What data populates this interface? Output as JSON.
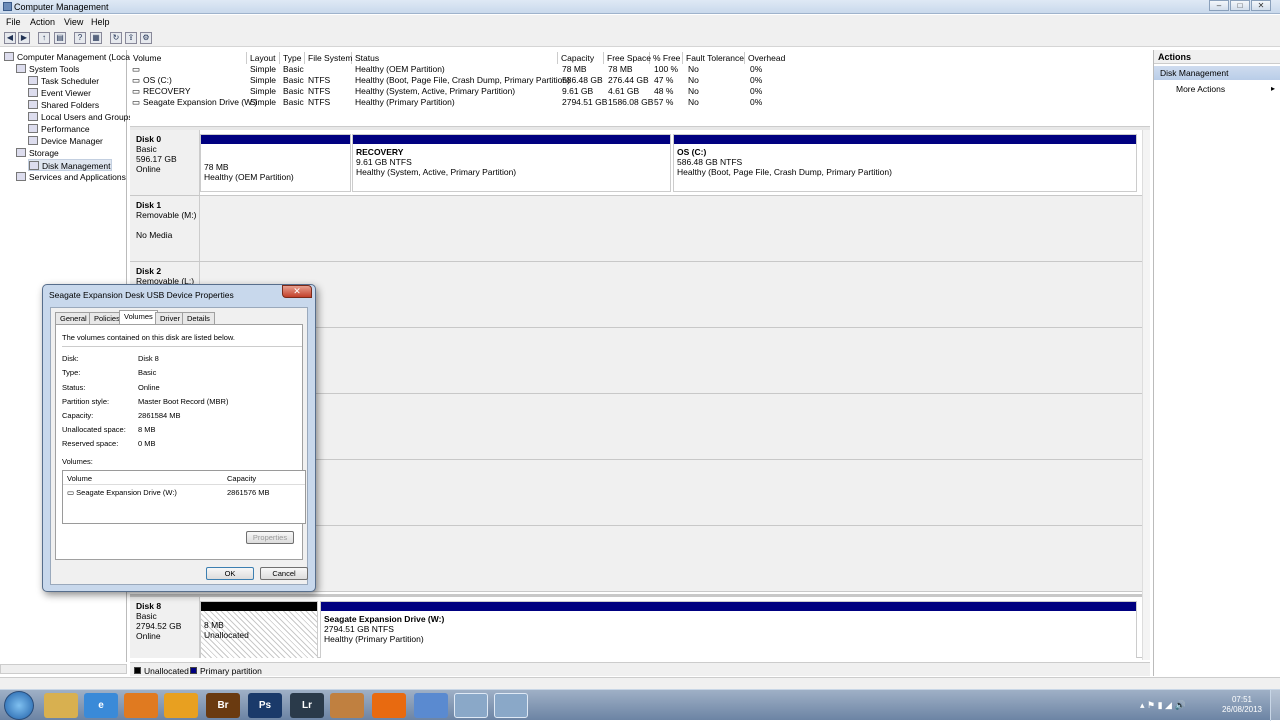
{
  "window": {
    "title": "Computer Management"
  },
  "menu": [
    "File",
    "Action",
    "View",
    "Help"
  ],
  "tree": [
    {
      "label": "Computer Management (Local",
      "icon": "computer-icon"
    },
    {
      "label": "System Tools",
      "icon": "tools-icon"
    },
    {
      "label": "Task Scheduler",
      "icon": "clock-icon"
    },
    {
      "label": "Event Viewer",
      "icon": "event-viewer-icon"
    },
    {
      "label": "Shared Folders",
      "icon": "folder-icon"
    },
    {
      "label": "Local Users and Groups",
      "icon": "users-icon"
    },
    {
      "label": "Performance",
      "icon": "performance-icon"
    },
    {
      "label": "Device Manager",
      "icon": "device-manager-icon"
    },
    {
      "label": "Storage",
      "icon": "storage-icon"
    },
    {
      "label": "Disk Management",
      "icon": "disk-icon"
    },
    {
      "label": "Services and Applications",
      "icon": "services-icon"
    }
  ],
  "volumes": {
    "headers": [
      "Volume",
      "Layout",
      "Type",
      "File System",
      "Status",
      "Capacity",
      "Free Space",
      "% Free",
      "Fault Tolerance",
      "Overhead"
    ],
    "rows": [
      [
        "",
        "Simple",
        "Basic",
        "",
        "Healthy (OEM Partition)",
        "78 MB",
        "78 MB",
        "100 %",
        "No",
        "0%"
      ],
      [
        "OS (C:)",
        "Simple",
        "Basic",
        "NTFS",
        "Healthy (Boot, Page File, Crash Dump, Primary Partition)",
        "586.48 GB",
        "276.44 GB",
        "47 %",
        "No",
        "0%"
      ],
      [
        "RECOVERY",
        "Simple",
        "Basic",
        "NTFS",
        "Healthy (System, Active, Primary Partition)",
        "9.61 GB",
        "4.61 GB",
        "48 %",
        "No",
        "0%"
      ],
      [
        "Seagate Expansion Drive (W:)",
        "Simple",
        "Basic",
        "NTFS",
        "Healthy (Primary Partition)",
        "2794.51 GB",
        "1586.08 GB",
        "57 %",
        "No",
        "0%"
      ]
    ]
  },
  "disks": {
    "disk0": {
      "name": "Disk 0",
      "type": "Basic",
      "size": "596.17 GB",
      "state": "Online",
      "p1": {
        "l1": "78 MB",
        "l2": "Healthy (OEM Partition)"
      },
      "p2": {
        "name": "RECOVERY",
        "l1": "9.61 GB NTFS",
        "l2": "Healthy (System, Active, Primary Partition)"
      },
      "p3": {
        "name": "OS  (C:)",
        "l1": "586.48 GB NTFS",
        "l2": "Healthy (Boot, Page File, Crash Dump, Primary Partition)"
      }
    },
    "disk1": {
      "name": "Disk 1",
      "type": "Removable (M:)",
      "state": "No Media"
    },
    "disk2": {
      "name": "Disk 2",
      "type": "Removable (L:)"
    },
    "disk8": {
      "name": "Disk 8",
      "type": "Basic",
      "size": "2794.52 GB",
      "state": "Online",
      "p1": {
        "l1": "8 MB",
        "l2": "Unallocated"
      },
      "p2": {
        "name": "Seagate Expansion Drive  (W:)",
        "l1": "2794.51 GB NTFS",
        "l2": "Healthy (Primary Partition)"
      }
    }
  },
  "legend": {
    "unallocated": "Unallocated",
    "primary": "Primary partition"
  },
  "actions": {
    "header": "Actions",
    "section": "Disk Management",
    "more": "More Actions"
  },
  "dialog": {
    "title": "Seagate Expansion Desk USB Device Properties",
    "tabs": [
      "General",
      "Policies",
      "Volumes",
      "Driver",
      "Details"
    ],
    "intro": "The volumes contained on this disk are listed below.",
    "fields": [
      {
        "label": "Disk:",
        "value": "Disk 8"
      },
      {
        "label": "Type:",
        "value": "Basic"
      },
      {
        "label": "Status:",
        "value": "Online"
      },
      {
        "label": "Partition style:",
        "value": "Master Boot Record (MBR)"
      },
      {
        "label": "Capacity:",
        "value": "2861584 MB"
      },
      {
        "label": "Unallocated space:",
        "value": "8 MB"
      },
      {
        "label": "Reserved space:",
        "value": "0 MB"
      }
    ],
    "volumes_label": "Volumes:",
    "col_volume": "Volume",
    "col_capacity": "Capacity",
    "vol_name": "Seagate Expansion Drive (W:)",
    "vol_capacity": "2861576 MB",
    "properties": "Properties",
    "ok": "OK",
    "cancel": "Cancel"
  },
  "taskbar": {
    "time": "07:51",
    "date": "26/08/2013",
    "apps": [
      "Br",
      "Ps",
      "Lr"
    ]
  },
  "colors": {
    "primary_partition": "#000080",
    "unallocated": "#000000"
  }
}
